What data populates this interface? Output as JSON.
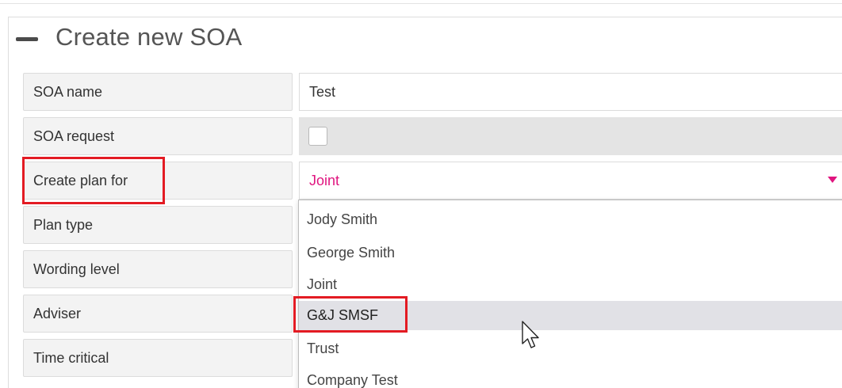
{
  "form": {
    "title": "Create new SOA",
    "fields": {
      "soa_name": {
        "label": "SOA name",
        "value": "Test"
      },
      "soa_request": {
        "label": "SOA request",
        "checked": false
      },
      "create_plan_for": {
        "label": "Create plan for",
        "selected": "Joint"
      },
      "plan_type": {
        "label": "Plan type"
      },
      "wording_level": {
        "label": "Wording level"
      },
      "adviser": {
        "label": "Adviser"
      },
      "time_critical": {
        "label": "Time critical"
      }
    }
  },
  "dropdown": {
    "options": [
      "Jody Smith",
      "George Smith",
      "Joint",
      "G&J SMSF",
      "Trust",
      "Company Test"
    ],
    "hovered": "G&J SMSF"
  },
  "colors": {
    "accent": "#e0157f",
    "highlight": "#e31b23",
    "label_bg": "#f3f3f3",
    "hover_bg": "#e1e1e6"
  },
  "icons": {
    "collapse": "minus-icon",
    "select": "caret-down-icon",
    "cursor": "mouse-pointer-icon"
  }
}
